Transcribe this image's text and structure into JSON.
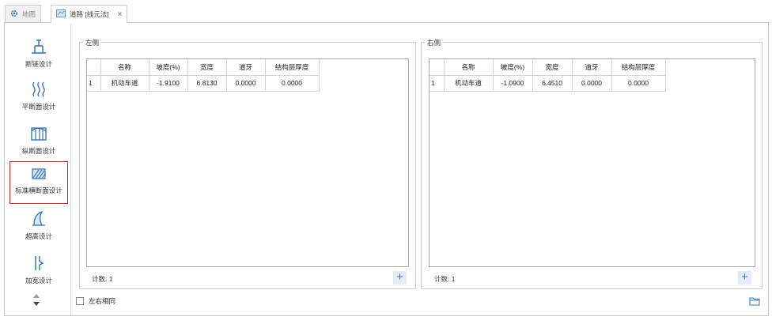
{
  "tabs": [
    {
      "label": "地图",
      "icon": "gear-icon",
      "active": false
    },
    {
      "label": "道路 [线元法]",
      "icon": "road-doc-icon",
      "active": true
    }
  ],
  "sidebar": {
    "items": [
      {
        "label": "断链设计",
        "icon": "chain-break-icon"
      },
      {
        "label": "平断面设计",
        "icon": "plan-curve-icon"
      },
      {
        "label": "纵断面设计",
        "icon": "profile-icon"
      },
      {
        "label": "标准横断面设计",
        "icon": "cross-section-icon",
        "selected": true
      },
      {
        "label": "超高设计",
        "icon": "superelevation-icon"
      },
      {
        "label": "加宽设计",
        "icon": "widening-icon"
      }
    ]
  },
  "left_panel": {
    "title": "左侧",
    "columns": [
      "名称",
      "坡度(%)",
      "宽度",
      "道牙",
      "结构层厚度"
    ],
    "rows": [
      [
        "1",
        "机动车道",
        "-1.9100",
        "6.8130",
        "0.0000",
        "0.0000"
      ]
    ],
    "count_label": "计数: 1",
    "add_label": "+"
  },
  "right_panel": {
    "title": "右侧",
    "columns": [
      "名称",
      "坡度(%)",
      "宽度",
      "道牙",
      "结构层厚度"
    ],
    "rows": [
      [
        "1",
        "机动车道",
        "-1.0900",
        "6.4510",
        "0.0000",
        "0.0000"
      ]
    ],
    "count_label": "计数: 1",
    "add_label": "+"
  },
  "footer": {
    "symmetric_label": "左右相同",
    "symmetric_checked": false
  },
  "colors": {
    "accent": "#3a78c2",
    "selection_border": "#d92a2a",
    "icon_blue": "#2f6db5"
  }
}
